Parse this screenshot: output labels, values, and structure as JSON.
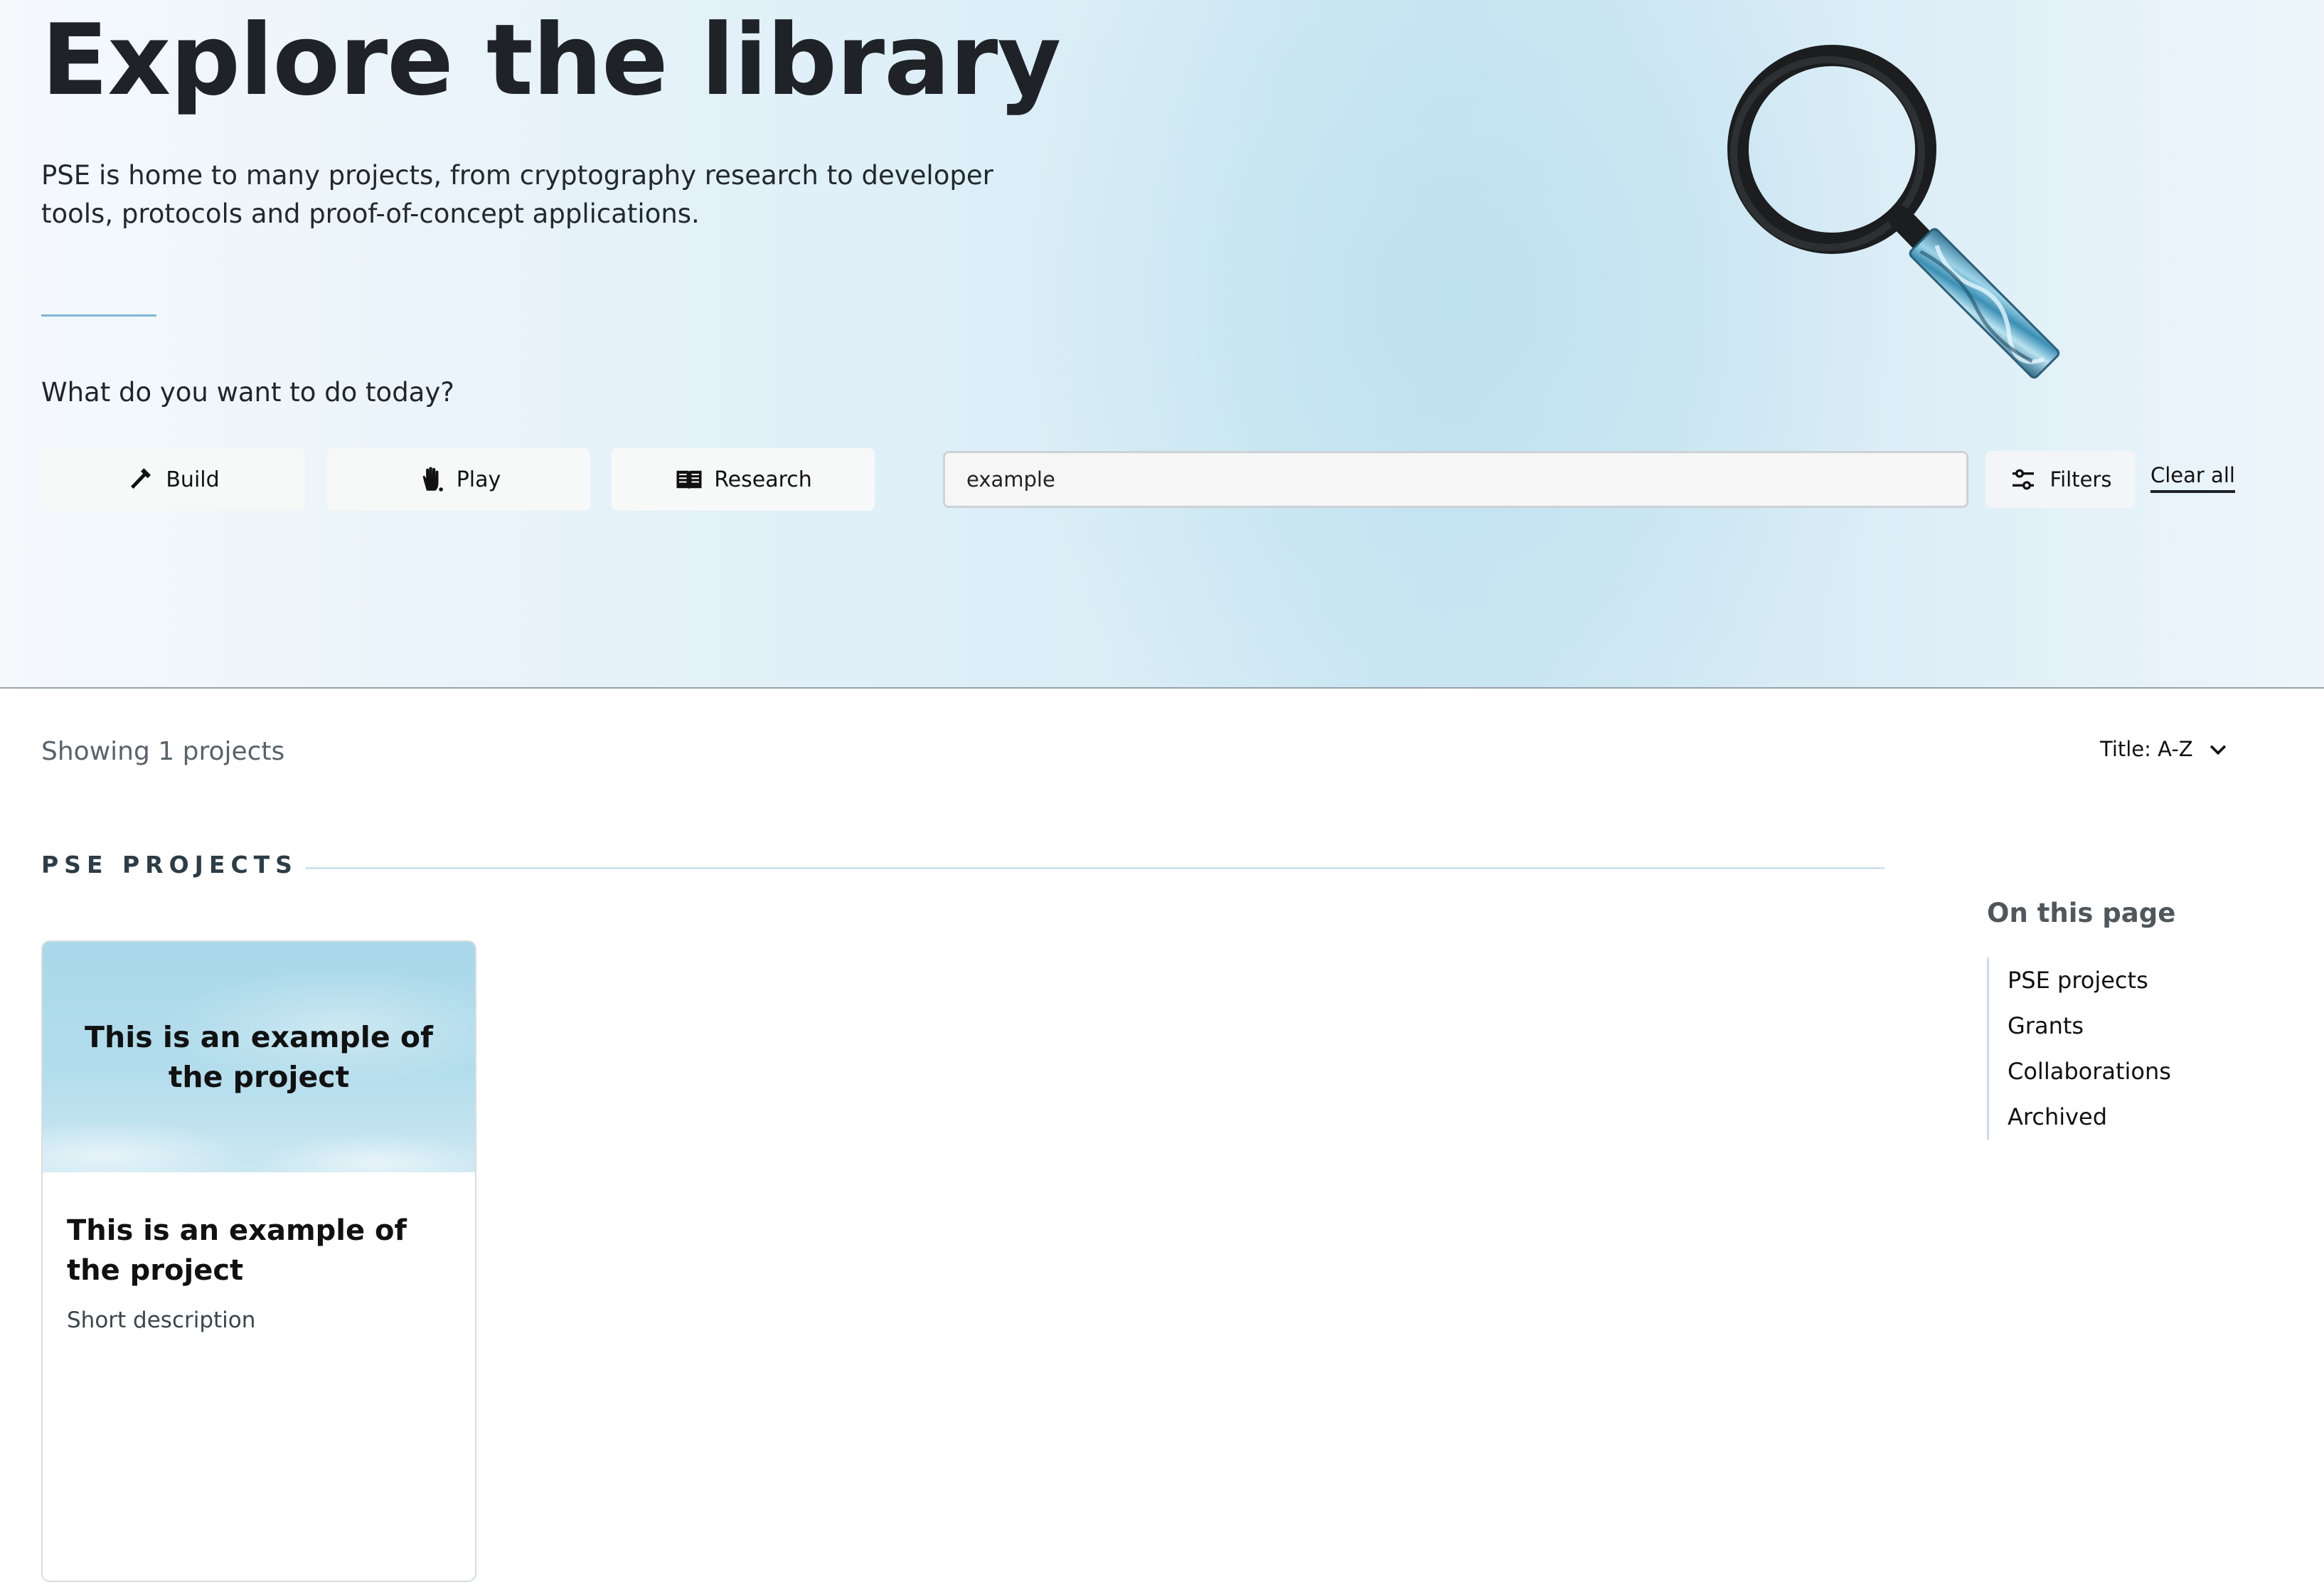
{
  "hero": {
    "title": "Explore the library",
    "description": "PSE is home to many projects, from cryptography research to developer tools, protocols and proof-of-concept applications.",
    "question": "What do you want to do today?",
    "categories": [
      {
        "label": "Build",
        "icon": "hammer-icon"
      },
      {
        "label": "Play",
        "icon": "hand-icon"
      },
      {
        "label": "Research",
        "icon": "book-icon"
      }
    ],
    "search": {
      "value": "example"
    },
    "filters_label": "Filters",
    "clear_all_label": "Clear all"
  },
  "results": {
    "count_text": "Showing 1 projects",
    "sort_label": "Title: A-Z"
  },
  "section": {
    "title": "PSE PROJECTS"
  },
  "projects": [
    {
      "image_text": "This is an example of the project",
      "title": "This is an example of the project",
      "description": "Short description"
    }
  ],
  "toc": {
    "title": "On this page",
    "items": [
      "PSE projects",
      "Grants",
      "Collaborations",
      "Archived"
    ]
  },
  "colors": {
    "accent_line": "#7fb7d6",
    "hero_bg": "#cde7f3"
  }
}
